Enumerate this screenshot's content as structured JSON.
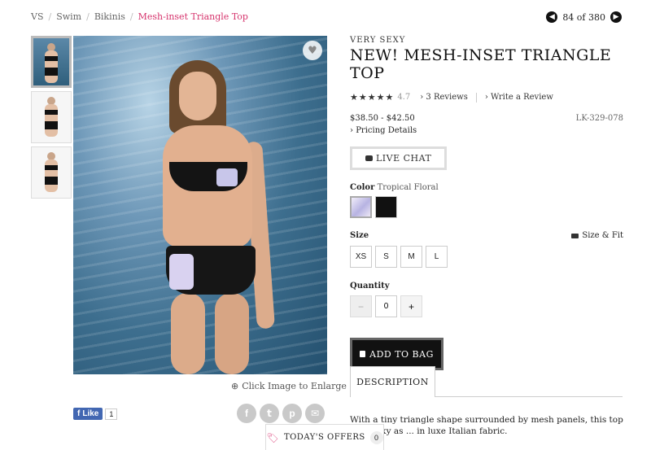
{
  "breadcrumb": {
    "items": [
      "VS",
      "Swim",
      "Bikinis"
    ],
    "current": "Mesh-inset Triangle Top"
  },
  "pager": {
    "text": "84 of 380"
  },
  "image": {
    "enlarge_label": "Click Image to Enlarge"
  },
  "social": {
    "like_label": "Like",
    "like_count": "1"
  },
  "product": {
    "brand": "VERY SEXY",
    "title": "NEW! MESH-INSET TRIANGLE TOP",
    "stars": "★★★★★",
    "rating": "4.7",
    "reviews_label": "3 Reviews",
    "write_review_label": "Write a Review",
    "price": "$38.50 - $42.50",
    "sku": "LK-329-078",
    "pricing_details_label": "Pricing Details",
    "live_chat_label": "LIVE CHAT",
    "color_label": "Color",
    "color_value": "Tropical Floral",
    "size_label": "Size",
    "size_fit_label": "Size & Fit",
    "sizes": [
      "XS",
      "S",
      "M",
      "L"
    ],
    "quantity_label": "Quantity",
    "quantity": "0",
    "minus": "−",
    "plus": "+",
    "add_to_bag_label": "ADD TO BAG"
  },
  "description": {
    "tab_label": "DESCRIPTION",
    "text": "With a tiny triangle shape surrounded by mesh panels, this top is as sexy as ... in luxe Italian fabric."
  },
  "offers": {
    "label": "TODAY'S OFFERS",
    "count": "0"
  },
  "colors": {
    "accent": "#d6336c",
    "button": "#111111"
  }
}
